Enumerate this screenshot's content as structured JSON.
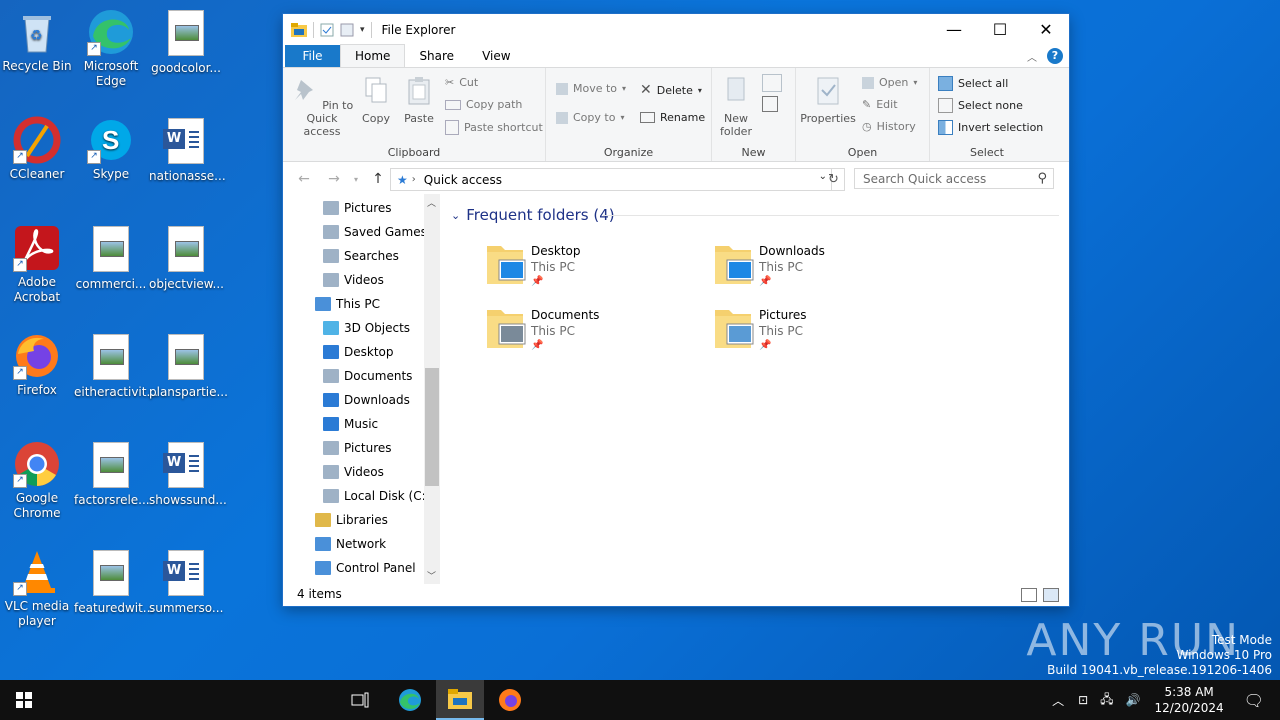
{
  "desktop": {
    "icons": [
      {
        "label": "Recycle Bin"
      },
      {
        "label": "Microsoft Edge"
      },
      {
        "label": "goodcolor..."
      },
      {
        "label": "CCleaner"
      },
      {
        "label": "Skype"
      },
      {
        "label": "nationasse..."
      },
      {
        "label": "Adobe Acrobat"
      },
      {
        "label": "commerci..."
      },
      {
        "label": "objectview..."
      },
      {
        "label": "Firefox"
      },
      {
        "label": "eitheractivit..."
      },
      {
        "label": "planspartie..."
      },
      {
        "label": "Google Chrome"
      },
      {
        "label": "factorsrele..."
      },
      {
        "label": "showssund..."
      },
      {
        "label": "VLC media player"
      },
      {
        "label": "featuredwit..."
      },
      {
        "label": "summerso..."
      }
    ]
  },
  "window": {
    "title": "File Explorer",
    "tabs": {
      "file": "File",
      "home": "Home",
      "share": "Share",
      "view": "View"
    },
    "ribbon": {
      "clipboard": {
        "group": "Clipboard",
        "pin": "Pin to Quick access",
        "copy": "Copy",
        "paste": "Paste",
        "cut": "Cut",
        "copy_path": "Copy path",
        "paste_shortcut": "Paste shortcut"
      },
      "organize": {
        "group": "Organize",
        "move_to": "Move to",
        "copy_to": "Copy to",
        "delete": "Delete",
        "rename": "Rename"
      },
      "new": {
        "group": "New",
        "new_folder": "New folder"
      },
      "open": {
        "group": "Open",
        "properties": "Properties",
        "open": "Open",
        "edit": "Edit",
        "history": "History"
      },
      "select": {
        "group": "Select",
        "select_all": "Select all",
        "select_none": "Select none",
        "invert": "Invert selection"
      }
    },
    "address": {
      "path": "Quick access",
      "search_placeholder": "Search Quick access"
    },
    "nav_items": [
      {
        "label": "Pictures",
        "indent": 2
      },
      {
        "label": "Saved Games",
        "indent": 2
      },
      {
        "label": "Searches",
        "indent": 2
      },
      {
        "label": "Videos",
        "indent": 2
      },
      {
        "label": "This PC",
        "indent": 1
      },
      {
        "label": "3D Objects",
        "indent": 2
      },
      {
        "label": "Desktop",
        "indent": 2
      },
      {
        "label": "Documents",
        "indent": 2
      },
      {
        "label": "Downloads",
        "indent": 2
      },
      {
        "label": "Music",
        "indent": 2
      },
      {
        "label": "Pictures",
        "indent": 2
      },
      {
        "label": "Videos",
        "indent": 2
      },
      {
        "label": "Local Disk (C:)",
        "indent": 2
      },
      {
        "label": "Libraries",
        "indent": 1
      },
      {
        "label": "Network",
        "indent": 1
      },
      {
        "label": "Control Panel",
        "indent": 1
      }
    ],
    "group_header": "Frequent folders (4)",
    "folders": [
      {
        "name": "Desktop",
        "location": "This PC"
      },
      {
        "name": "Downloads",
        "location": "This PC"
      },
      {
        "name": "Documents",
        "location": "This PC"
      },
      {
        "name": "Pictures",
        "location": "This PC"
      }
    ],
    "status": "4 items"
  },
  "taskbar": {
    "time": "5:38 AM",
    "date": "12/20/2024"
  },
  "watermark": {
    "line1": "Test Mode",
    "line2": "Windows 10 Pro",
    "line3": "Build 19041.vb_release.191206-1406",
    "brand": "ANY RUN"
  }
}
